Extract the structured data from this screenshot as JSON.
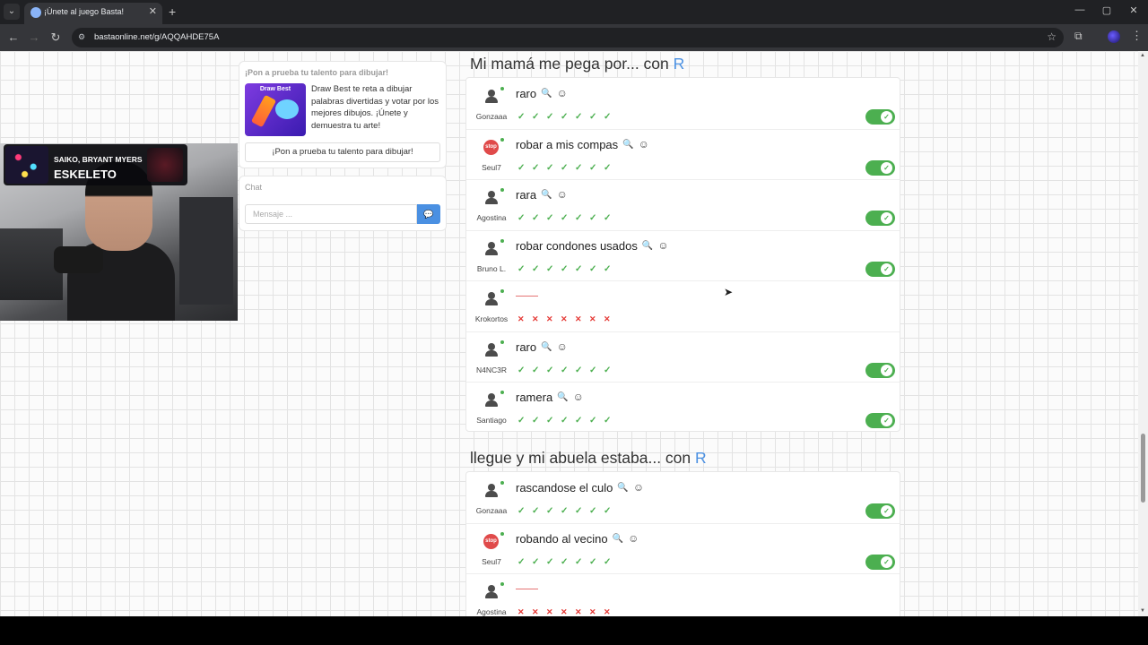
{
  "browser": {
    "tab_title": "¡Únete al juego Basta!",
    "url": "bastaonline.net/g/AQQAHDE75A",
    "window_controls": [
      "—",
      "▢",
      "✕"
    ]
  },
  "music": {
    "artist": "SAIKO, BRYANT MYERS",
    "title": "ESKELETO"
  },
  "promo": {
    "heading": "¡Pon a prueba tu talento para dibujar!",
    "image_title": "Draw Best",
    "text": "Draw Best te reta a dibujar palabras divertidas y votar por los mejores dibujos. ¡Únete y demuestra tu arte!",
    "button": "¡Pon a prueba tu talento para dibujar!"
  },
  "chat": {
    "title": "Chat",
    "placeholder": "Mensaje ..."
  },
  "sections": [
    {
      "title": "Mi mamá me pega por... con",
      "letter": "R",
      "rows": [
        {
          "user": "Gonzaaa",
          "avatar": "person",
          "answer": "raro",
          "votes": [
            1,
            1,
            1,
            1,
            1,
            1,
            1
          ],
          "accepted": true
        },
        {
          "user": "Seul7",
          "avatar": "stop",
          "answer": "robar a mis compas",
          "votes": [
            1,
            1,
            1,
            1,
            1,
            1,
            1
          ],
          "accepted": true
        },
        {
          "user": "Agostina",
          "avatar": "person",
          "answer": "rara",
          "votes": [
            1,
            1,
            1,
            1,
            1,
            1,
            1
          ],
          "accepted": true
        },
        {
          "user": "Bruno L.",
          "avatar": "person",
          "answer": "robar condones usados",
          "votes": [
            1,
            1,
            1,
            1,
            1,
            1,
            1
          ],
          "accepted": true
        },
        {
          "user": "Krokortos",
          "avatar": "person",
          "answer": "",
          "votes": [
            0,
            0,
            0,
            0,
            0,
            0,
            0
          ],
          "accepted": false
        },
        {
          "user": "N4NC3R",
          "avatar": "person",
          "answer": "raro",
          "votes": [
            1,
            1,
            1,
            1,
            1,
            1,
            1
          ],
          "accepted": true
        },
        {
          "user": "Santiago",
          "avatar": "person",
          "answer": "ramera",
          "votes": [
            1,
            1,
            1,
            1,
            1,
            1,
            1
          ],
          "accepted": true
        }
      ]
    },
    {
      "title": "llegue y mi abuela estaba... con",
      "letter": "R",
      "rows": [
        {
          "user": "Gonzaaa",
          "avatar": "person",
          "answer": "rascandose el culo",
          "votes": [
            1,
            1,
            1,
            1,
            1,
            1,
            1
          ],
          "accepted": true
        },
        {
          "user": "Seul7",
          "avatar": "stop",
          "answer": "robando al vecino",
          "votes": [
            1,
            1,
            1,
            1,
            1,
            1,
            1
          ],
          "accepted": true
        },
        {
          "user": "Agostina",
          "avatar": "person",
          "answer": "",
          "votes": [
            0,
            0,
            0,
            0,
            0,
            0,
            0
          ],
          "accepted": false
        }
      ]
    }
  ],
  "icons": {
    "stop_badge": "stop",
    "vote_ok": "✓",
    "vote_bad": "✕",
    "search": "🔍",
    "smile": "☺",
    "toggle_check": "✓"
  },
  "colors": {
    "accent": "#4a90e2",
    "ok": "#4caf50",
    "bad": "#e53935"
  }
}
